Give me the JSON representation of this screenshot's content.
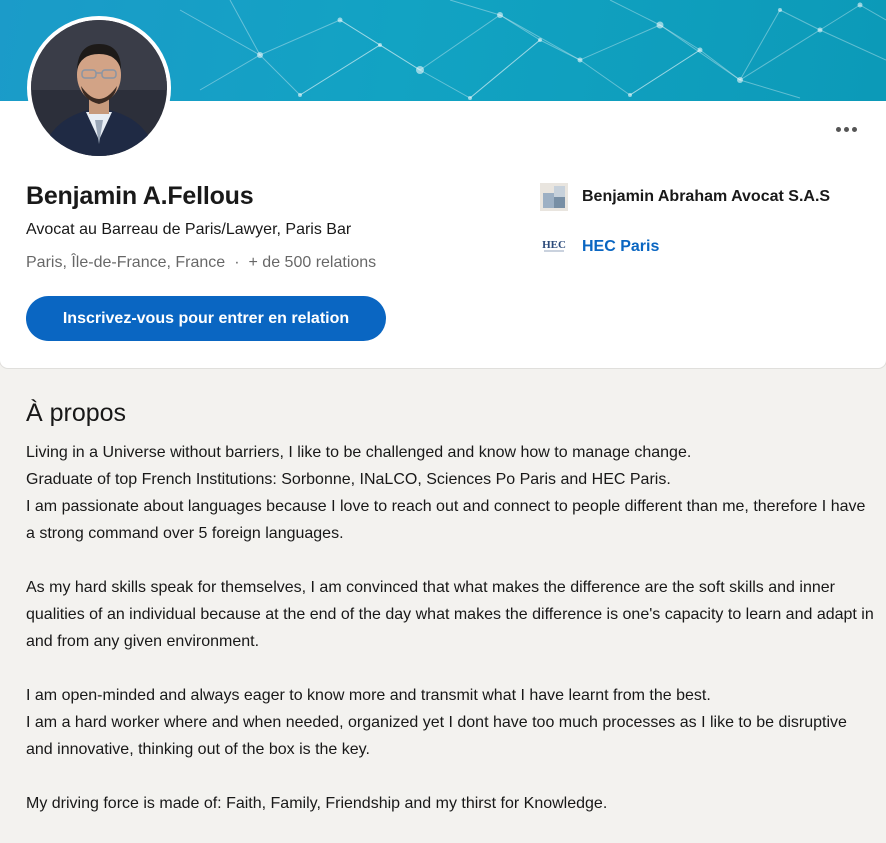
{
  "profile": {
    "name": "Benjamin A.Fellous",
    "headline": "Avocat au Barreau de Paris/Lawyer, Paris Bar",
    "location": "Paris, Île-de-France, France",
    "separator": "·",
    "connections": "+ de 500 relations",
    "connect_label": "Inscrivez-vous pour entrer en relation"
  },
  "organizations": {
    "company": {
      "name": "Benjamin Abraham Avocat S.A.S",
      "icon": "company-logo-icon"
    },
    "school": {
      "name": "HEC Paris",
      "icon": "hec-logo-icon",
      "logo_text": "HEC"
    }
  },
  "about": {
    "title": "À propos",
    "paragraphs": [
      "Living in a Universe without barriers, I like to be challenged and know how to manage change.",
      "Graduate of top French Institutions: Sorbonne, INaLCO, Sciences Po Paris and HEC Paris.",
      "I am passionate about languages because I love to reach out and connect to people different than me, therefore I have a strong command over 5 foreign languages.",
      "As my hard skills speak for themselves, I am convinced that what makes the difference are the soft skills and inner qualities of an individual because at the end of the day what makes the difference is one's capacity to learn and adapt in and from any given environment.",
      "I am open-minded and always eager to know more and transmit what I have learnt from the best.",
      "I am a hard worker where and when needed, organized yet I dont have too much processes as I like to be disruptive and innovative, thinking out of the box is the key.",
      "My driving force is made of: Faith, Family, Friendship and my thirst for Knowledge."
    ]
  },
  "colors": {
    "accent": "#0a66c2",
    "banner": "#12a3c3"
  }
}
